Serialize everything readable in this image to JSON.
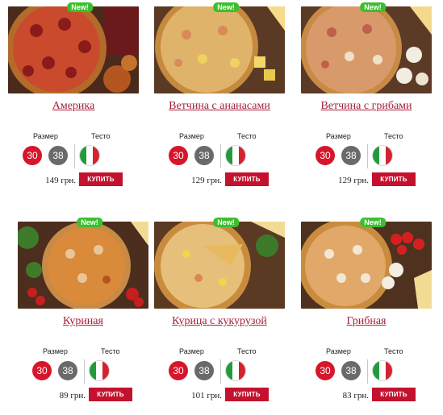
{
  "labels": {
    "size": "Размер",
    "dough": "Тесто"
  },
  "badge_text": "New!",
  "buy_label": "КУПИТЬ",
  "currency_suffix": "грн.",
  "flag_colors": [
    "#239a3c",
    "#ffffff",
    "#d3232f"
  ],
  "products": [
    {
      "name": "Америка",
      "sizes": [
        "30",
        "38"
      ],
      "active_size": "30",
      "price": "149 грн.",
      "dough": "italian-flag-icon"
    },
    {
      "name": "Ветчина с ананасами",
      "sizes": [
        "30",
        "38"
      ],
      "active_size": "30",
      "price": "129 грн.",
      "dough": "italian-flag-icon"
    },
    {
      "name": "Ветчина с грибами",
      "sizes": [
        "30",
        "38"
      ],
      "active_size": "30",
      "price": "129 грн.",
      "dough": "italian-flag-icon"
    },
    {
      "name": "Куриная",
      "sizes": [
        "30",
        "38"
      ],
      "active_size": "30",
      "price": "89 грн.",
      "dough": "italian-flag-icon"
    },
    {
      "name": "Курица с кукурузой",
      "sizes": [
        "30",
        "38"
      ],
      "active_size": "30",
      "price": "101 грн.",
      "dough": "italian-flag-icon"
    },
    {
      "name": "Грибная",
      "sizes": [
        "30",
        "38"
      ],
      "active_size": "30",
      "price": "83 грн.",
      "dough": "italian-flag-icon"
    }
  ]
}
